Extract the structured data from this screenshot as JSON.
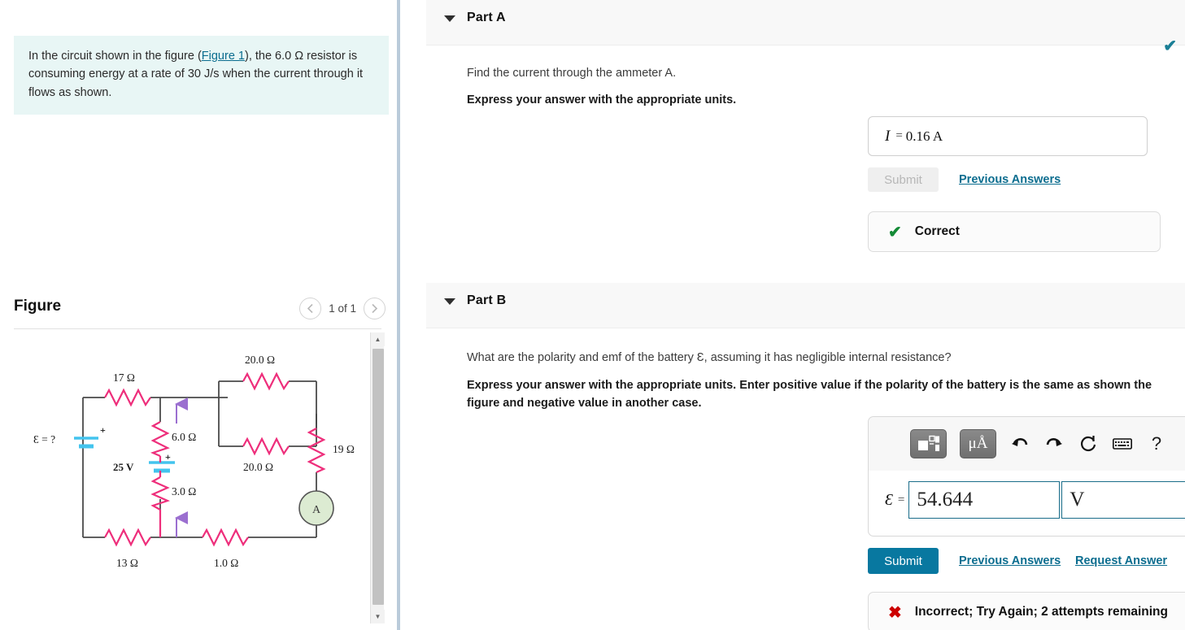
{
  "problem": {
    "text_before_link": "In the circuit shown in the figure (",
    "figure_link": "Figure 1",
    "text_after_link": "), the 6.0 Ω resistor is consuming energy at a rate of 30 J/s when the current through it flows as shown."
  },
  "figure": {
    "title": "Figure",
    "counter": "1 of 1",
    "prev_icon": "chevron-left-icon",
    "next_icon": "chevron-right-icon",
    "circuit": {
      "emf_label": "Ɛ = ?",
      "battery_25v_label": "25 V",
      "ammeter_label": "A",
      "resistors": [
        {
          "name": "r17",
          "label": "17 Ω"
        },
        {
          "name": "r20_top",
          "label": "20.0 Ω"
        },
        {
          "name": "r20_bottom",
          "label": "20.0 Ω"
        },
        {
          "name": "r19",
          "label": "19 Ω"
        },
        {
          "name": "r6",
          "label": "6.0 Ω"
        },
        {
          "name": "r3",
          "label": "3.0 Ω"
        },
        {
          "name": "r13",
          "label": "13 Ω"
        },
        {
          "name": "r1",
          "label": "1.0 Ω"
        }
      ],
      "plus_signs": [
        "+",
        "+"
      ],
      "colors": {
        "resistor": "#ee2e7b",
        "wire": "#4a4a4a",
        "battery": "#43c4ee",
        "current_arrow": "#9b6fd0",
        "ammeter_fill": "#dcebd2"
      }
    }
  },
  "parts": [
    {
      "id": "A",
      "label": "Part A",
      "caret_icon": "caret-down-icon",
      "status_icon": "check-icon",
      "status_color": "#1a7f96",
      "question": "Find the current through the ammeter A.",
      "instruction": "Express your answer with the appropriate units.",
      "answer": {
        "variable": "I",
        "equals": "=",
        "value": "0.16 A"
      },
      "submit_label": "Submit",
      "submit_enabled": false,
      "links": [
        "Previous Answers"
      ],
      "feedback": {
        "mark": "✔",
        "mark_color": "#138a36",
        "text": "Correct"
      }
    },
    {
      "id": "B",
      "label": "Part B",
      "caret_icon": "caret-down-icon",
      "question": "What are the polarity and emf of the battery Ɛ, assuming it has negligible internal resistance?",
      "instruction": "Express your answer with the appropriate units. Enter positive value if the polarity of the battery is the same as shown the figure and negative value in another case.",
      "toolbar": [
        {
          "name": "template-button",
          "icon": "math-template-icon",
          "label": ""
        },
        {
          "name": "units-button",
          "icon": "mu-angstrom-icon",
          "label": "μÅ"
        },
        {
          "name": "undo-button",
          "icon": "undo-arrow-icon",
          "label": "↩"
        },
        {
          "name": "redo-button",
          "icon": "redo-arrow-icon",
          "label": "↪"
        },
        {
          "name": "reset-button",
          "icon": "refresh-icon",
          "label": "⟳"
        },
        {
          "name": "keyboard-button",
          "icon": "keyboard-icon",
          "label": "⌨"
        },
        {
          "name": "help-button",
          "icon": "question-mark-icon",
          "label": "?"
        }
      ],
      "answer": {
        "variable": "Ɛ",
        "equals": "=",
        "value": "54.644",
        "unit": "V"
      },
      "submit_label": "Submit",
      "submit_enabled": true,
      "links": [
        "Previous Answers",
        "Request Answer"
      ],
      "feedback": {
        "mark": "✖",
        "mark_color": "#cc0000",
        "text": "Incorrect; Try Again; 2 attempts remaining"
      }
    }
  ]
}
